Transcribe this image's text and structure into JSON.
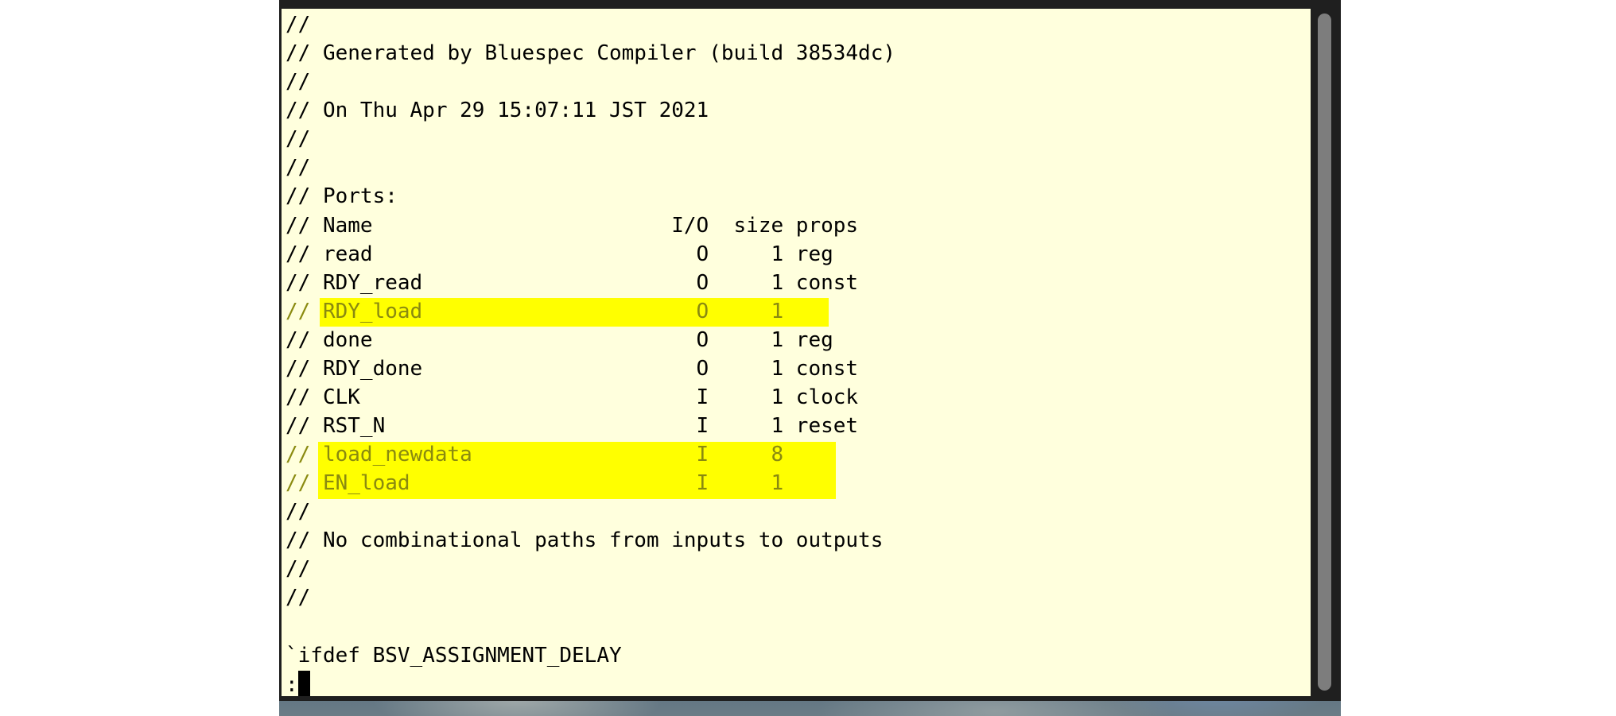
{
  "terminal": {
    "lines": [
      "//",
      "// Generated by Bluespec Compiler (build 38534dc)",
      "//",
      "// On Thu Apr 29 15:07:11 JST 2021",
      "//",
      "//",
      "// Ports:",
      "// Name                        I/O  size props",
      "// read                          O     1 reg",
      "// RDY_read                      O     1 const",
      "// RDY_load                      O     1",
      "// done                          O     1 reg",
      "// RDY_done                      O     1 const",
      "// CLK                           I     1 clock",
      "// RST_N                         I     1 reset",
      "// load_newdata                  I     8",
      "// EN_load                       I     1",
      "//",
      "// No combinational paths from inputs to outputs",
      "//",
      "//",
      "",
      "`ifdef BSV_ASSIGNMENT_DELAY"
    ],
    "prompt": ":",
    "highlighted_lines": [
      "RDY_load",
      "load_newdata",
      "EN_load"
    ]
  },
  "colors": {
    "terminal_background": "#ffffdd",
    "highlight": "#ffff00",
    "highlighted_text": "#8a8a10",
    "window_frame": "#1f1f1f"
  }
}
